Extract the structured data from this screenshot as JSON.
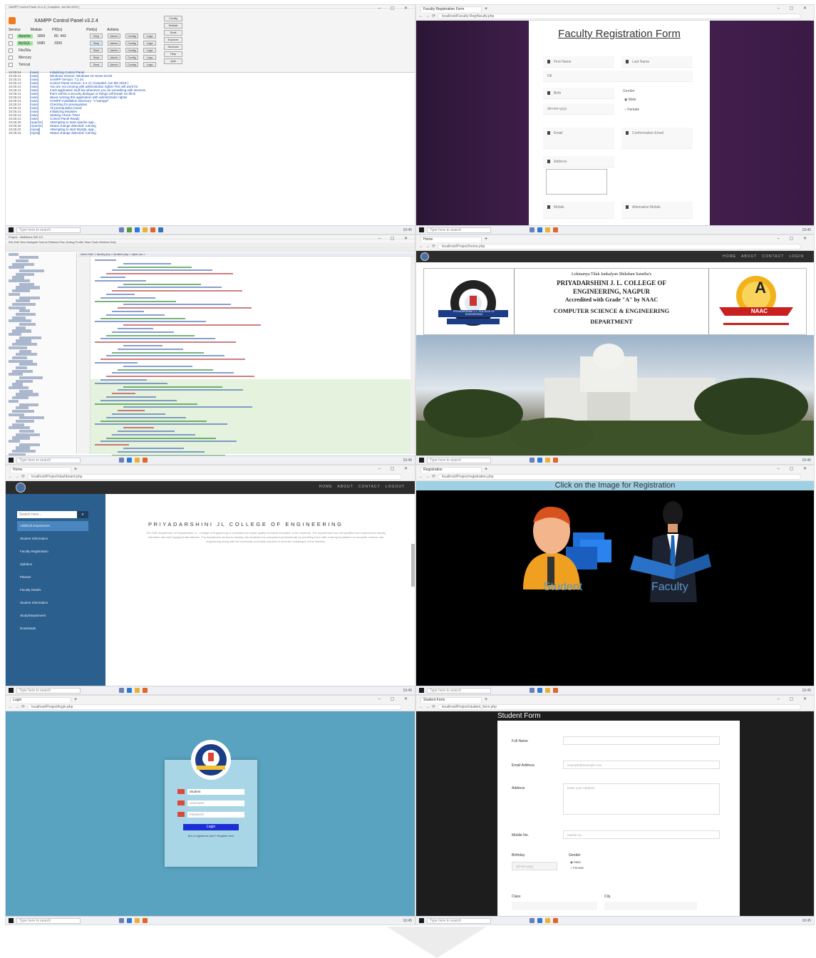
{
  "common": {
    "taskbar_search": "Type here to search",
    "tray_time": "10:45",
    "window_controls": "– ▢ ✕"
  },
  "xampp": {
    "window_title": "XAMPP Control Panel v3.2.4 [ Compiled: Jun 5th 2019 ]",
    "title": "XAMPP Control Panel v3.2.4",
    "headers": [
      "Service",
      "Module",
      "PID(s)",
      "Port(s)",
      "Actions"
    ],
    "modules": [
      {
        "name": "Apache",
        "running": true,
        "pid": "1868",
        "port": "80, 443",
        "action": "Stop"
      },
      {
        "name": "MySQL",
        "running": true,
        "pid": "5080",
        "port": "3306",
        "action": "Stop"
      },
      {
        "name": "FileZilla",
        "running": false,
        "pid": "",
        "port": "",
        "action": "Start"
      },
      {
        "name": "Mercury",
        "running": false,
        "pid": "",
        "port": "",
        "action": "Start"
      },
      {
        "name": "Tomcat",
        "running": false,
        "pid": "",
        "port": "",
        "action": "Start"
      }
    ],
    "row_buttons": [
      "Admin",
      "Config",
      "Logs"
    ],
    "side_buttons": [
      "Config",
      "Netstat",
      "Shell",
      "Explorer",
      "Services",
      "Help",
      "Quit"
    ],
    "log": [
      {
        "time": "10:25:14",
        "src": "[main]",
        "msg": "Initializing Control Panel"
      },
      {
        "time": "10:25:14",
        "src": "[main]",
        "msg": "Windows Version: Windows 10 Home 64-bit"
      },
      {
        "time": "10:25:14",
        "src": "[main]",
        "msg": "XAMPP Version: 7.2.34"
      },
      {
        "time": "10:25:14",
        "src": "[main]",
        "msg": "Control Panel Version: 3.2.4 [ Compiled: Jun 5th 2019 ]"
      },
      {
        "time": "10:25:14",
        "src": "[main]",
        "msg": "You are not running with administrator rights! This will work for"
      },
      {
        "time": "10:25:14",
        "src": "[main]",
        "msg": "most application stuff but whenever you do something with services"
      },
      {
        "time": "10:25:14",
        "src": "[main]",
        "msg": "there will be a security dialogue or things will break! So think"
      },
      {
        "time": "10:25:14",
        "src": "[main]",
        "msg": "about running this application with administrator rights!"
      },
      {
        "time": "10:25:14",
        "src": "[main]",
        "msg": "XAMPP Installation Directory: \"c:\\xampp\\\""
      },
      {
        "time": "10:25:14",
        "src": "[main]",
        "msg": "Checking for prerequisites"
      },
      {
        "time": "10:25:14",
        "src": "[main]",
        "msg": "All prerequisites found"
      },
      {
        "time": "10:25:14",
        "src": "[main]",
        "msg": "Initializing Modules"
      },
      {
        "time": "10:25:14",
        "src": "[main]",
        "msg": "Starting Check-Timer"
      },
      {
        "time": "10:25:14",
        "src": "[main]",
        "msg": "Control Panel Ready"
      },
      {
        "time": "10:25:20",
        "src": "[Apache]",
        "msg": "Attempting to start Apache app..."
      },
      {
        "time": "10:25:20",
        "src": "[Apache]",
        "msg": "Status change detected: running"
      },
      {
        "time": "10:25:22",
        "src": "[mysql]",
        "msg": "Attempting to start MySQL app..."
      },
      {
        "time": "10:25:22",
        "src": "[mysql]",
        "msg": "Status change detected: running"
      }
    ]
  },
  "faculty": {
    "tab": "Faculty Registration Form",
    "url": "localhost/Faculty-Reg/faculty.php",
    "title": "Faculty Registration Form",
    "fields": [
      "First Name",
      "Last Name",
      "Fill",
      "Birth",
      "dd-mm-yyyy",
      "Email",
      "Conformation Email",
      "Address",
      "Mobile",
      "Alternative Mobile"
    ],
    "gender_label": "Gender",
    "gender_options": [
      "Male",
      "Female"
    ]
  },
  "ide": {
    "title": "Project - NetBeans IDE 8.2",
    "menu": "File  Edit  View  Navigate  Source  Refactor  Run  Debug  Profile  Team  Tools  Window  Help",
    "tabs": "index.html  ×   faculty.php  ×   student.php  ×   style.css  ×"
  },
  "college": {
    "tab": "Home",
    "url": "localhost/Project/home.php",
    "nav": [
      "HOME",
      "ABOUT",
      "CONTACT",
      "LOGIN"
    ],
    "lines": [
      "Lokmanya Tilak Jankalyan Shikshan Sanstha's",
      "PRIYADARSHINI J. L. COLLEGE OF",
      "ENGINEERING, NAGPUR",
      "Accredited with Grade \"A\" by NAAC",
      "COMPUTER SCIENCE & ENGINEERING",
      "DEPARTMENT"
    ],
    "naac_grade": "A",
    "naac_label": "NAAC",
    "logo_label": "PRIYADARSHINI J. L. COLLEGE OF ENGINEERING"
  },
  "dashboard": {
    "tab": "Home",
    "url": "localhost/Project/dashboard.php",
    "nav": [
      "HOME",
      "ABOUT",
      "CONTACT",
      "LOGOUT"
    ],
    "search_placeholder": "Search here...",
    "menu": [
      "Add/Edit Department",
      "Student Information",
      "Faculty Registration",
      "Syllabus",
      "Planner",
      "Faculty Details",
      "Student Information",
      "Study/Department",
      "Downloads"
    ],
    "heading": "PRIYADARSHINI JL COLLEGE OF ENGINEERING",
    "paragraph": "The CSE department of Priyadarshini J.L. College of Engineering is committed to impart quality technical education to the students. The department has well qualified and experienced faculty members and well equipped laboratories. The department strives to develop the students into competent professionals by providing them with a strong foundation in computer science and engineering along with the necessary soft skills required to meet the challenges of the industry."
  },
  "registration": {
    "tab": "Registration",
    "url": "localhost/Project/registration.php",
    "header": "Click on the Image for Registration",
    "options": [
      "Student",
      "Faculty"
    ]
  },
  "login": {
    "tab": "Login",
    "url": "localhost/Project/login.php",
    "role": "Student",
    "username_placeholder": "Username",
    "password_placeholder": "Password",
    "button": "Login",
    "footer": "Not a registered user? Register here"
  },
  "student_form": {
    "tab": "Student Form",
    "url": "localhost/Project/student_form.php",
    "title": "Student Form",
    "labels": [
      "Full Name",
      "Email Address",
      "Address",
      "Mobile No.",
      "Birthday",
      "Gender",
      "Class",
      "City"
    ],
    "placeholders": [
      "",
      "example@example.com",
      "Enter your Address",
      "Mobile no.",
      "dd-mm-yyyy"
    ],
    "gender_options": [
      "Male",
      "Female"
    ]
  }
}
